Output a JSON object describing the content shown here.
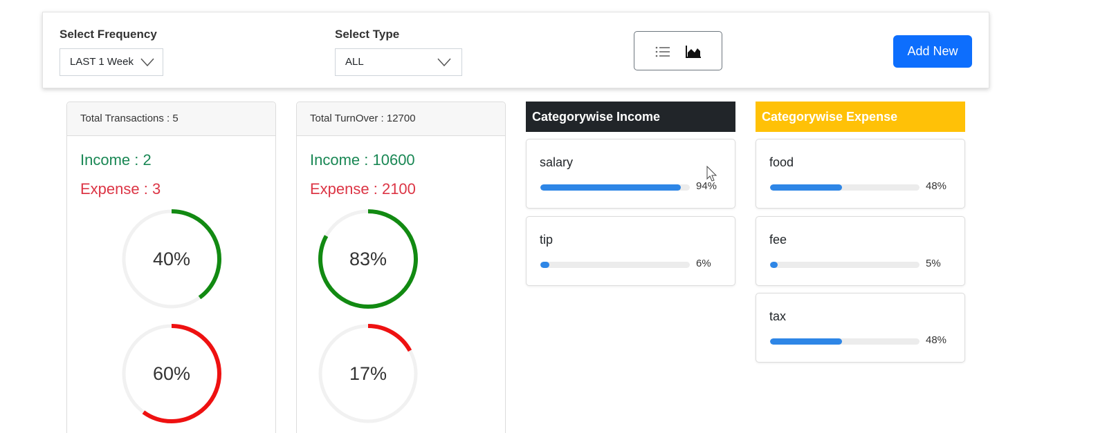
{
  "filters": {
    "frequency_label": "Select Frequency",
    "frequency_value": "LAST 1 Week",
    "type_label": "Select Type",
    "type_value": "ALL"
  },
  "view_toggle": {
    "list_icon": "list-icon",
    "chart_icon": "area-chart-icon"
  },
  "add_button": "Add New",
  "transactions": {
    "header": "Total Transactions : 5",
    "income": "Income : 2",
    "expense": "Expense : 3",
    "income_percent": 40,
    "expense_percent": 60,
    "income_label": "40%",
    "expense_label": "60%"
  },
  "turnover": {
    "header": "Total TurnOver : 12700",
    "income": "Income : 10600",
    "expense": "Expense : 2100",
    "income_percent": 83,
    "expense_percent": 17,
    "income_label": "83%",
    "expense_label": "17%"
  },
  "colors": {
    "income_ring": "#128a12",
    "expense_ring": "#ee1111",
    "ring_track": "#f1f1f1",
    "bar": "#2e86e6"
  },
  "category_income": {
    "title": "Categorywise Income",
    "items": [
      {
        "name": "salary",
        "percent": 94,
        "label": "94%"
      },
      {
        "name": "tip",
        "percent": 6,
        "label": "6%"
      }
    ]
  },
  "category_expense": {
    "title": "Categorywise Expense",
    "items": [
      {
        "name": "food",
        "percent": 48,
        "label": "48%"
      },
      {
        "name": "fee",
        "percent": 5,
        "label": "5%"
      },
      {
        "name": "tax",
        "percent": 48,
        "label": "48%"
      }
    ]
  }
}
